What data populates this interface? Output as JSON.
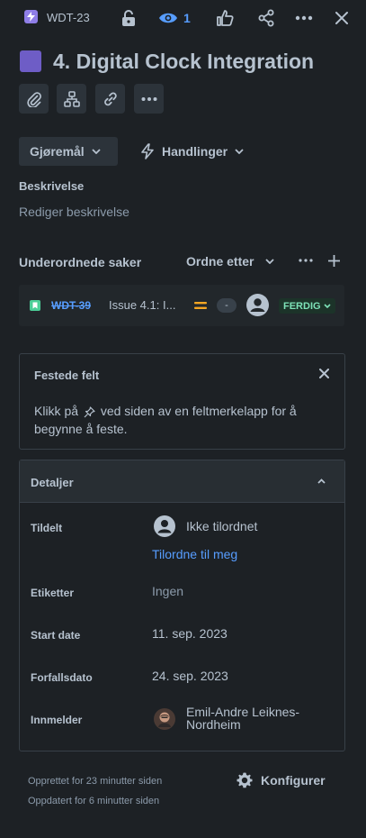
{
  "header": {
    "issue_key": "WDT-23",
    "watch_count": "1",
    "colors": {
      "epic": "#8f7ee7",
      "watch": "#579dff"
    },
    "icons": [
      "lightning-icon",
      "unlock-icon",
      "eye-icon",
      "thumbs-up-icon",
      "share-icon",
      "more-icon",
      "close-icon"
    ]
  },
  "issue": {
    "title": "4. Digital Clock Integration",
    "title_color": "#6e5dc6"
  },
  "toolbar": {
    "icons": [
      "paperclip-icon",
      "hierarchy-icon",
      "link-icon",
      "more-icon"
    ],
    "status_label": "Gjøremål",
    "actions_label": "Handlinger"
  },
  "description": {
    "heading": "Beskrivelse",
    "placeholder": "Rediger beskrivelse"
  },
  "children": {
    "heading": "Underordnede saker",
    "sort_label": "Ordne etter",
    "items": [
      {
        "key": "WDT-39",
        "summary": "Issue 4.1: I...",
        "estimate": "-",
        "status": "FERDIG",
        "priority": "medium",
        "type": "story"
      }
    ]
  },
  "pinned": {
    "heading": "Festede felt",
    "body_before": "Klikk på",
    "body_after": "ved siden av en feltmerkelapp for å begynne å feste."
  },
  "details": {
    "heading": "Detaljer",
    "assignee_label": "Tildelt",
    "assignee_value": "Ikke tilordnet",
    "assign_to_me": "Tilordne til meg",
    "labels_label": "Etiketter",
    "labels_value": "Ingen",
    "start_label": "Start date",
    "start_value": "11. sep. 2023",
    "due_label": "Forfallsdato",
    "due_value": "24. sep. 2023",
    "reporter_label": "Innmelder",
    "reporter_line1": "Emil-Andre Leiknes-",
    "reporter_line2": "Nordheim"
  },
  "footer": {
    "created": "Opprettet for 23 minutter siden",
    "updated": "Oppdatert for 6 minutter siden",
    "configure": "Konfigurer"
  }
}
